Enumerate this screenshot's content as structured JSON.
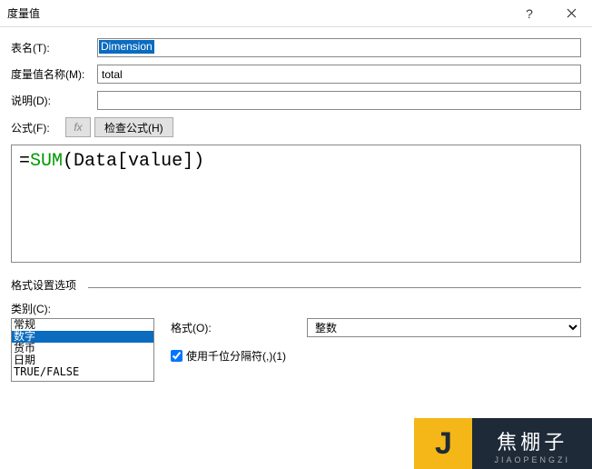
{
  "titlebar": {
    "title": "度量值"
  },
  "labels": {
    "table": "表名(T):",
    "measure": "度量值名称(M):",
    "desc": "说明(D):",
    "formula": "公式(F):",
    "checkFormula": "检查公式(H)",
    "formatOptions": "格式设置选项",
    "category": "类别(C):",
    "format": "格式(O):",
    "thousands": "使用千位分隔符(,)(1)"
  },
  "fields": {
    "table": "Dimension",
    "measure": "total",
    "desc": "",
    "formatSel": "整数"
  },
  "formula": {
    "eq": "=",
    "fn": "SUM",
    "open": "(",
    "arg": "Data[value]",
    "close": ")"
  },
  "categories": [
    "常规",
    "数字",
    "货币",
    "日期",
    "TRUE/FALSE"
  ],
  "thousandsChecked": true,
  "watermark": {
    "j": "J",
    "cn": "焦棚子",
    "py": "JIAOPENGZI"
  }
}
